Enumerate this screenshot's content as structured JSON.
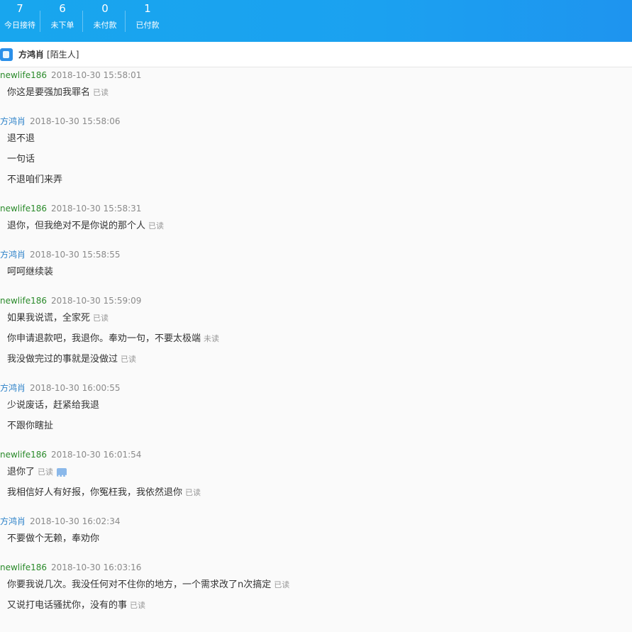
{
  "stats": [
    {
      "value": "7",
      "label": "今日接待"
    },
    {
      "value": "6",
      "label": "未下单"
    },
    {
      "value": "0",
      "label": "未付款"
    },
    {
      "value": "1",
      "label": "已付款"
    }
  ],
  "contact": {
    "name": "方鸿肖",
    "tag": "[陌生人]"
  },
  "messages": [
    {
      "sender": "newlife186",
      "time": "2018-10-30 15:58:01",
      "lines": [
        {
          "text": "你这是要强加我罪名",
          "status": "已读"
        }
      ]
    },
    {
      "sender": "方鸿肖",
      "time": "2018-10-30 15:58:06",
      "lines": [
        {
          "text": "退不退"
        },
        {
          "text": "一句话"
        },
        {
          "text": "不退咱们来弄"
        }
      ]
    },
    {
      "sender": "newlife186",
      "time": "2018-10-30 15:58:31",
      "lines": [
        {
          "text": "退你，但我绝对不是你说的那个人",
          "status": "已读"
        }
      ]
    },
    {
      "sender": "方鸿肖",
      "time": "2018-10-30 15:58:55",
      "lines": [
        {
          "text": "呵呵继续装"
        }
      ]
    },
    {
      "sender": "newlife186",
      "time": "2018-10-30 15:59:09",
      "lines": [
        {
          "text": "如果我说谎，全家死",
          "status": "已读"
        },
        {
          "text": "你申请退款吧，我退你。奉劝一句，不要太极端",
          "status": "未读"
        },
        {
          "text": "我没做完过的事就是没做过",
          "status": "已读"
        }
      ]
    },
    {
      "sender": "方鸿肖",
      "time": "2018-10-30 16:00:55",
      "lines": [
        {
          "text": "少说废话，赶紧给我退"
        },
        {
          "text": "不跟你瞎扯"
        }
      ]
    },
    {
      "sender": "newlife186",
      "time": "2018-10-30 16:01:54",
      "lines": [
        {
          "text": "退你了",
          "status": "已读",
          "more": true
        },
        {
          "text": "我相信好人有好报，你冤枉我，我依然退你",
          "status": "已读"
        }
      ]
    },
    {
      "sender": "方鸿肖",
      "time": "2018-10-30 16:02:34",
      "lines": [
        {
          "text": "不要做个无赖，奉劝你"
        }
      ]
    },
    {
      "sender": "newlife186",
      "time": "2018-10-30 16:03:16",
      "lines": [
        {
          "text": "你要我说几次。我没任何对不住你的地方，一个需求改了n次搞定",
          "status": "已读"
        },
        {
          "text": "又说打电话骚扰你，没有的事",
          "status": "已读"
        }
      ]
    }
  ],
  "colors": {
    "self": "#2a8a2a",
    "other": "#2d82c9",
    "topbar": "#18a6ee"
  }
}
